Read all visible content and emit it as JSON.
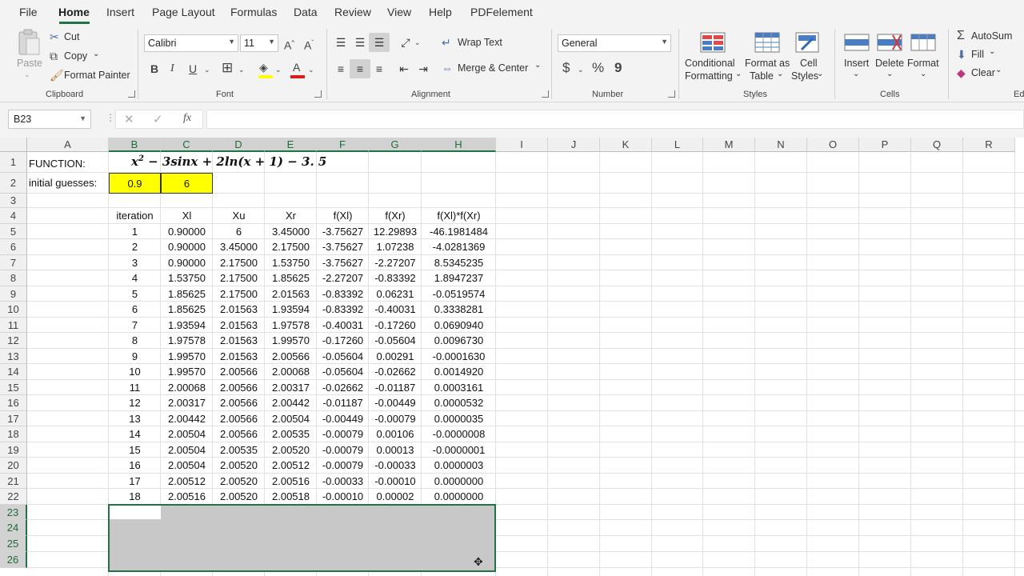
{
  "tabs": [
    "File",
    "Home",
    "Insert",
    "Page Layout",
    "Formulas",
    "Data",
    "Review",
    "View",
    "Help",
    "PDFelement"
  ],
  "active_tab": "Home",
  "clipboard": {
    "paste": "Paste",
    "cut": "Cut",
    "copy": "Copy",
    "format_painter": "Format Painter",
    "label": "Clipboard"
  },
  "font": {
    "name": "Calibri",
    "size": "11",
    "label": "Font",
    "bold": "B",
    "italic": "I",
    "underline": "U"
  },
  "alignment": {
    "wrap_text": "Wrap Text",
    "merge_center": "Merge & Center",
    "label": "Alignment"
  },
  "number": {
    "format": "General",
    "label": "Number",
    "currency": "$",
    "percent": "%",
    "comma": "9"
  },
  "styles": {
    "conditional": [
      "Conditional",
      "Formatting"
    ],
    "format_table": [
      "Format as",
      "Table"
    ],
    "cell_styles": [
      "Cell",
      "Styles"
    ],
    "label": "Styles"
  },
  "cells": {
    "insert": "Insert",
    "delete": "Delete",
    "format": "Format",
    "label": "Cells"
  },
  "editing": {
    "autosum": "AutoSum",
    "fill": "Fill",
    "clear": "Clear",
    "label": "Ed"
  },
  "formula_bar": {
    "name_box": "B23",
    "fx": "fx",
    "content": ""
  },
  "columns": [
    "A",
    "B",
    "C",
    "D",
    "E",
    "F",
    "G",
    "H",
    "I",
    "J",
    "K",
    "L",
    "M",
    "N",
    "O",
    "P",
    "Q",
    "R"
  ],
  "rows": [
    "1",
    "2",
    "3",
    "4",
    "5",
    "6",
    "7",
    "8",
    "9",
    "10",
    "11",
    "12",
    "13",
    "14",
    "15",
    "16",
    "17",
    "18",
    "19",
    "20",
    "21",
    "22",
    "23",
    "24",
    "25",
    "26"
  ],
  "sheet": {
    "a1": "FUNCTION:",
    "function_text": {
      "p1": "x",
      "sup": "2",
      "p2": " − 3sinx + 2ln(x + 1) − 3. 5"
    },
    "a2": "initial guesses:",
    "b2": "0.9",
    "c2": "6",
    "headers": [
      "iteration",
      "Xl",
      "Xu",
      "Xr",
      "f(Xl)",
      "f(Xr)",
      "f(Xl)*f(Xr)"
    ],
    "table": [
      [
        "1",
        "0.90000",
        "6",
        "3.45000",
        "-3.75627",
        "12.29893",
        "-46.1981484"
      ],
      [
        "2",
        "0.90000",
        "3.45000",
        "2.17500",
        "-3.75627",
        "1.07238",
        "-4.0281369"
      ],
      [
        "3",
        "0.90000",
        "2.17500",
        "1.53750",
        "-3.75627",
        "-2.27207",
        "8.5345235"
      ],
      [
        "4",
        "1.53750",
        "2.17500",
        "1.85625",
        "-2.27207",
        "-0.83392",
        "1.8947237"
      ],
      [
        "5",
        "1.85625",
        "2.17500",
        "2.01563",
        "-0.83392",
        "0.06231",
        "-0.0519574"
      ],
      [
        "6",
        "1.85625",
        "2.01563",
        "1.93594",
        "-0.83392",
        "-0.40031",
        "0.3338281"
      ],
      [
        "7",
        "1.93594",
        "2.01563",
        "1.97578",
        "-0.40031",
        "-0.17260",
        "0.0690940"
      ],
      [
        "8",
        "1.97578",
        "2.01563",
        "1.99570",
        "-0.17260",
        "-0.05604",
        "0.0096730"
      ],
      [
        "9",
        "1.99570",
        "2.01563",
        "2.00566",
        "-0.05604",
        "0.00291",
        "-0.0001630"
      ],
      [
        "10",
        "1.99570",
        "2.00566",
        "2.00068",
        "-0.05604",
        "-0.02662",
        "0.0014920"
      ],
      [
        "11",
        "2.00068",
        "2.00566",
        "2.00317",
        "-0.02662",
        "-0.01187",
        "0.0003161"
      ],
      [
        "12",
        "2.00317",
        "2.00566",
        "2.00442",
        "-0.01187",
        "-0.00449",
        "0.0000532"
      ],
      [
        "13",
        "2.00442",
        "2.00566",
        "2.00504",
        "-0.00449",
        "-0.00079",
        "0.0000035"
      ],
      [
        "14",
        "2.00504",
        "2.00566",
        "2.00535",
        "-0.00079",
        "0.00106",
        "-0.0000008"
      ],
      [
        "15",
        "2.00504",
        "2.00535",
        "2.00520",
        "-0.00079",
        "0.00013",
        "-0.0000001"
      ],
      [
        "16",
        "2.00504",
        "2.00520",
        "2.00512",
        "-0.00079",
        "-0.00033",
        "0.0000003"
      ],
      [
        "17",
        "2.00512",
        "2.00520",
        "2.00516",
        "-0.00033",
        "-0.00010",
        "0.0000000"
      ],
      [
        "18",
        "2.00516",
        "2.00520",
        "2.00518",
        "-0.00010",
        "0.00002",
        "0.0000000"
      ]
    ]
  },
  "colors": {
    "accent": "#217346",
    "highlight": "#ffff00",
    "selection": "#c8c8c8"
  }
}
